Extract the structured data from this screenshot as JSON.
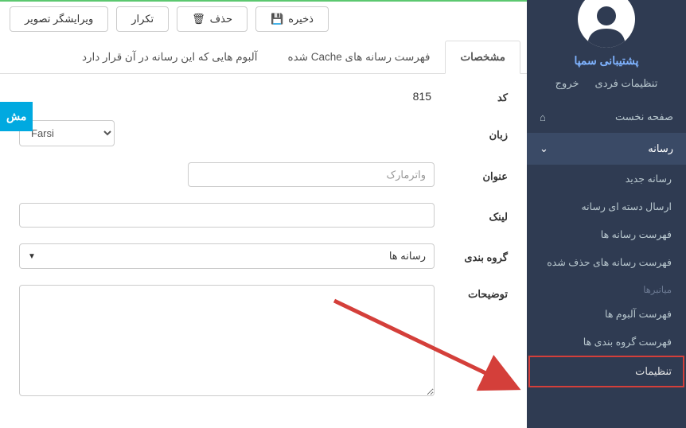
{
  "sidebar": {
    "support_label": "پشتیبانی سمپا",
    "personal_settings": "تنظیمات فردی",
    "logout": "خروج",
    "home": "صفحه نخست",
    "media": "رسانه",
    "new_media": "رسانه جدید",
    "bulk_send": "ارسال دسته ای رسانه",
    "media_list": "فهرست رسانه ها",
    "deleted_media_list": "فهرست رسانه های حذف شده",
    "shortcuts": "میانبرها",
    "album_list": "فهرست آلبوم ها",
    "group_list": "فهرست گروه بندی ها",
    "settings": "تنظیمات"
  },
  "toolbar": {
    "editor": "ویرایشگر تصویر",
    "repeat": "تکرار",
    "delete": "حذف",
    "save": "ذخیره"
  },
  "tabs": {
    "specs": "مشخصات",
    "cache_list": "فهرست رسانه های Cache شده",
    "albums": "آلبوم هایی که این رسانه در آن قرار دارد"
  },
  "form": {
    "code_label": "کد",
    "code_value": "815",
    "lang_label": "زبان",
    "lang_value": "Farsi",
    "title_label": "عنوان",
    "title_placeholder": "واترمارک",
    "link_label": "لینک",
    "group_label": "گروه بندی",
    "group_placeholder": "رسانه ها",
    "desc_label": "توضیحات"
  },
  "float": {
    "label": "مش"
  }
}
